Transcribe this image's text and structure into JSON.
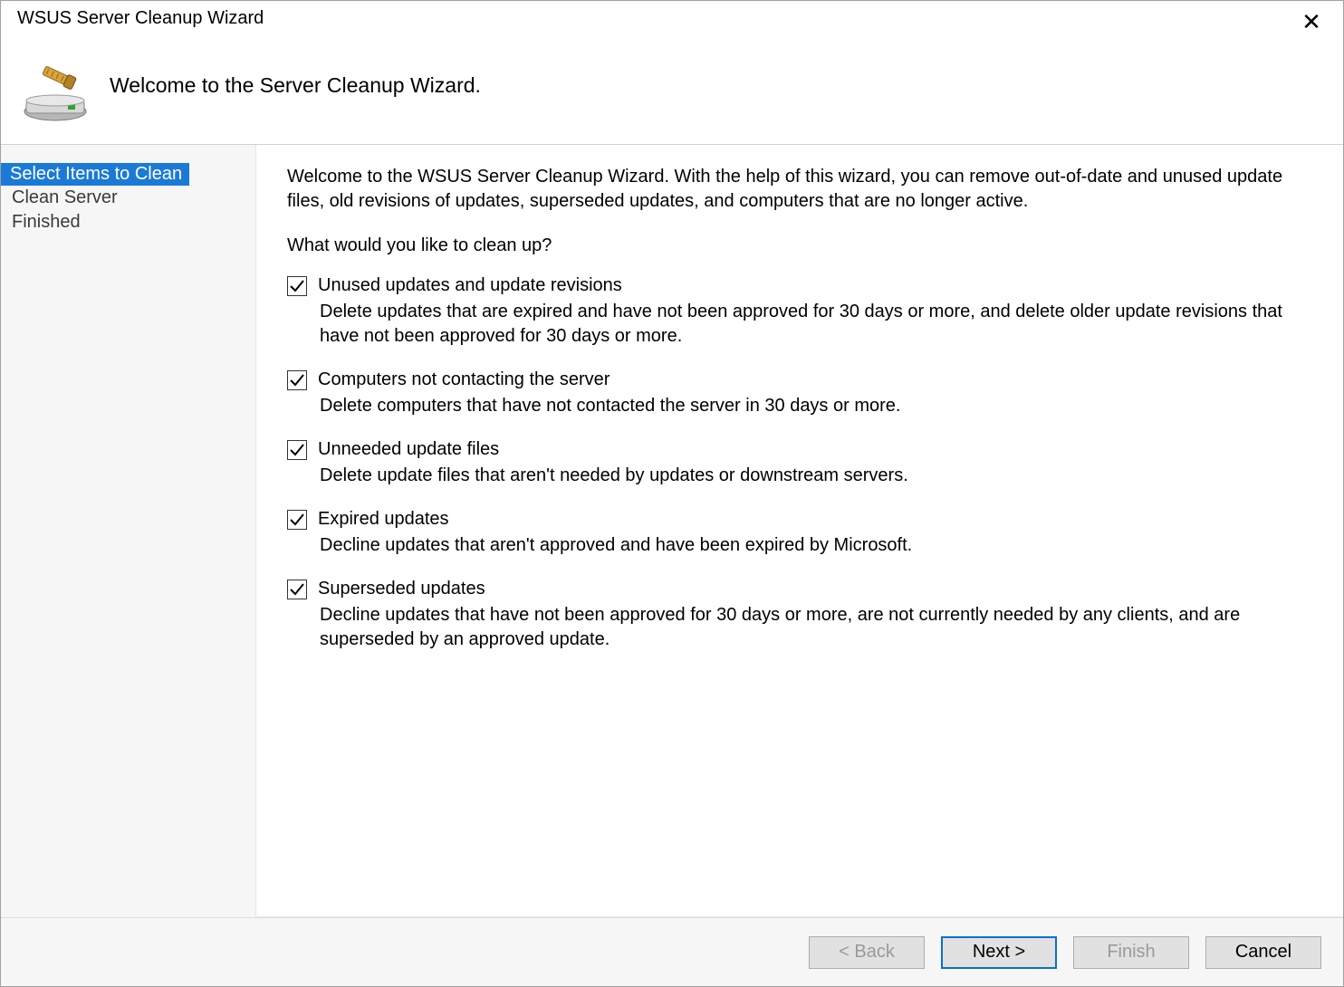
{
  "window": {
    "title": "WSUS Server Cleanup Wizard"
  },
  "header": {
    "subtitle": "Welcome to the Server Cleanup Wizard."
  },
  "sidebar": {
    "steps": [
      {
        "label": "Select Items to Clean",
        "active": true
      },
      {
        "label": "Clean Server",
        "active": false
      },
      {
        "label": "Finished",
        "active": false
      }
    ]
  },
  "main": {
    "intro": "Welcome to the WSUS Server Cleanup Wizard. With the help of this wizard, you can remove out-of-date and unused update files, old revisions of updates, superseded updates, and computers that are no longer active.",
    "question": "What would you like to clean up?",
    "options": [
      {
        "checked": true,
        "label": "Unused updates and update revisions",
        "desc": "Delete updates that are expired and have not been approved for 30 days or more, and delete older update revisions that have not been approved for 30 days or more."
      },
      {
        "checked": true,
        "label": "Computers not contacting the server",
        "desc": "Delete computers that have not contacted the server in 30 days or more."
      },
      {
        "checked": true,
        "label": "Unneeded update files",
        "desc": "Delete update files that aren't needed by updates or downstream servers."
      },
      {
        "checked": true,
        "label": "Expired updates",
        "desc": "Decline updates that aren't approved and have been expired by Microsoft."
      },
      {
        "checked": true,
        "label": "Superseded updates",
        "desc": "Decline updates that have not been approved for 30 days or more, are not currently needed by any clients, and are superseded by an approved update."
      }
    ]
  },
  "footer": {
    "back": "< Back",
    "next": "Next >",
    "finish": "Finish",
    "cancel": "Cancel"
  }
}
